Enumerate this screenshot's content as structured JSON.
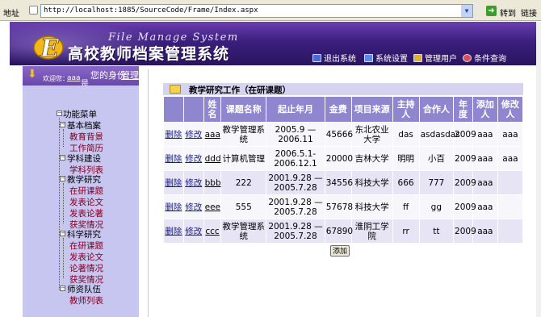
{
  "browser": {
    "addr_label": "地址",
    "url": "http://localhost:1885/SourceCode/Frame/Index.aspx",
    "go_label": "转到",
    "more": "链接"
  },
  "banner": {
    "title_en": "File Manage System",
    "title_cn": "高校教师档案管理系统",
    "toolbar": [
      {
        "label": "退出系统",
        "icon": "exit-icon"
      },
      {
        "label": "系统设置",
        "icon": "settings-icon"
      },
      {
        "label": "管理用户",
        "icon": "users-icon"
      },
      {
        "label": "条件查询",
        "icon": "search-icon"
      }
    ]
  },
  "welcome": {
    "text": "欢迎您：",
    "user": "aaa",
    "suffix": "是",
    "identity_label": "您的身份：",
    "identity": "管理"
  },
  "menu": {
    "root": "功能菜单",
    "groups": [
      {
        "label": "基本档案",
        "items": [
          "教育背景",
          "工作简历"
        ]
      },
      {
        "label": "学科建设",
        "items": [
          "学科列表"
        ]
      },
      {
        "label": "教学研究",
        "items": [
          "在研课题",
          "发表论文",
          "发表论著",
          "获奖情况"
        ]
      },
      {
        "label": "科学研究",
        "items": [
          "在研课题",
          "发表论文",
          "论著情况",
          "获奖情况"
        ]
      },
      {
        "label": "师资队伍",
        "items": [
          "教师列表"
        ]
      }
    ]
  },
  "content": {
    "title": "教学研究工作（在研课题）",
    "columns": [
      "",
      "",
      "姓名",
      "课题名称",
      "起止年月",
      "金费",
      "项目来源",
      "主持人",
      "合作人",
      "年度",
      "添加人",
      "修改人"
    ],
    "rows": [
      {
        "delete": "删除",
        "edit": "修改",
        "name": "aaa",
        "topic": "教学管理系统",
        "period": "2005.9 — 2006.11",
        "fund": "45666",
        "source": "东北农业大学",
        "host": "das",
        "partner": "asdasdas",
        "year": "2009",
        "added_by": "aaa",
        "modified_by": "aaa"
      },
      {
        "delete": "删除",
        "edit": "修改",
        "name": "ddd",
        "topic": "计算机管理",
        "period": "2006.5.1- 2006.12.1",
        "fund": "20000",
        "source": "吉林大学",
        "host": "明明",
        "partner": "小百",
        "year": "2009",
        "added_by": "aaa",
        "modified_by": "aaa"
      },
      {
        "delete": "删除",
        "edit": "修改",
        "name": "bbb",
        "topic": "222",
        "period": "2001.9.28 — 2005.7.28",
        "fund": "34556",
        "source": "科技大学",
        "host": "666",
        "partner": "777",
        "year": "2009",
        "added_by": "aaa",
        "modified_by": ""
      },
      {
        "delete": "删除",
        "edit": "修改",
        "name": "eee",
        "topic": "555",
        "period": "2001.9.28 — 2005.7.28",
        "fund": "57678",
        "source": "科技大学",
        "host": "ff",
        "partner": "gg",
        "year": "2009",
        "added_by": "aaa",
        "modified_by": ""
      },
      {
        "delete": "删除",
        "edit": "修改",
        "name": "ccc",
        "topic": "教学管理系统",
        "period": "2001.9.28 — 2005.7.28",
        "fund": "67890",
        "source": "淮阴工学院",
        "host": "rr",
        "partner": "tt",
        "year": "2009",
        "added_by": "aaa",
        "modified_by": ""
      }
    ],
    "add_button": "添加"
  }
}
